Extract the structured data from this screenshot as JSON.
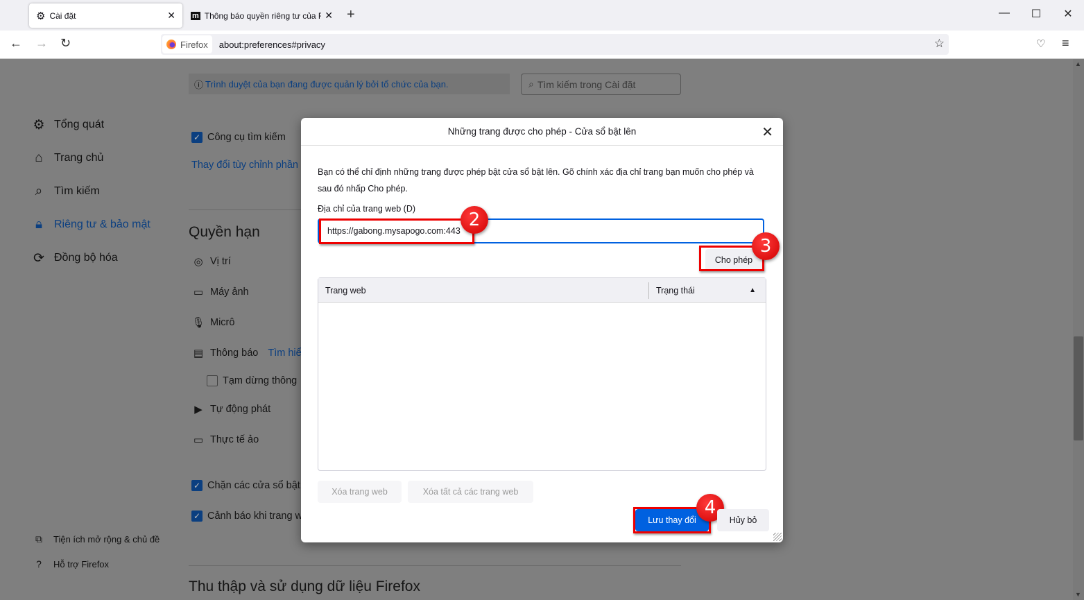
{
  "tabs": [
    {
      "label": "Cài đặt",
      "icon": "gear-icon"
    },
    {
      "label": "Thông báo quyền riêng tư của F",
      "icon": "m-favicon"
    }
  ],
  "new_tab": "+",
  "window": {
    "minimize": "—",
    "maximize": "☐",
    "close": "✕"
  },
  "nav": {
    "identity": "Firefox",
    "url": "about:preferences#privacy"
  },
  "banner": "Trình duyệt của bạn đang được quản lý bởi tổ chức của bạn.",
  "search_placeholder": "Tìm kiếm trong Cài đặt",
  "sidebar": {
    "items": [
      {
        "label": "Tổng quát",
        "icon": "gear-icon"
      },
      {
        "label": "Trang chủ",
        "icon": "home-icon"
      },
      {
        "label": "Tìm kiếm",
        "icon": "search-icon"
      },
      {
        "label": "Riêng tư & bảo mật",
        "icon": "lock-icon",
        "active": true
      },
      {
        "label": "Đồng bộ hóa",
        "icon": "sync-icon"
      }
    ],
    "footer": [
      {
        "label": "Tiện ích mở rộng & chủ đề"
      },
      {
        "label": "Hỗ trợ Firefox"
      }
    ]
  },
  "main": {
    "search_engines": "Công cụ tìm kiếm",
    "change_link": "Thay đổi tùy chỉnh phần",
    "permissions_heading": "Quyền hạn",
    "permissions": [
      "Vị trí",
      "Máy ảnh",
      "Micrô",
      "Thông báo"
    ],
    "learn_more": "Tìm hiể",
    "pause_notifications": "Tạm dừng thông",
    "autoplay": "Tự động phát",
    "vr": "Thực tế ảo",
    "block_popups": "Chặn các cửa sổ bật",
    "warn_addons": "Cảnh báo khi trang w",
    "data_heading": "Thu thập và sử dụng dữ liệu Firefox"
  },
  "dialog": {
    "title": "Những trang được cho phép - Cửa sổ bật lên",
    "description": "Bạn có thể chỉ định những trang được phép bật cửa sổ bật lên. Gõ chính xác địa chỉ trang bạn muốn cho phép và sau đó nhấp Cho phép.",
    "address_label": "Địa chỉ của trang web (D)",
    "address_value": "https://gabong.mysapogo.com:443",
    "allow": "Cho phép",
    "col_site": "Trang web",
    "col_status": "Trạng thái",
    "remove": "Xóa trang web",
    "remove_all": "Xóa tất cả các trang web",
    "save": "Lưu thay đổi",
    "cancel": "Hủy bỏ"
  },
  "annotations": [
    "2",
    "3",
    "4"
  ]
}
